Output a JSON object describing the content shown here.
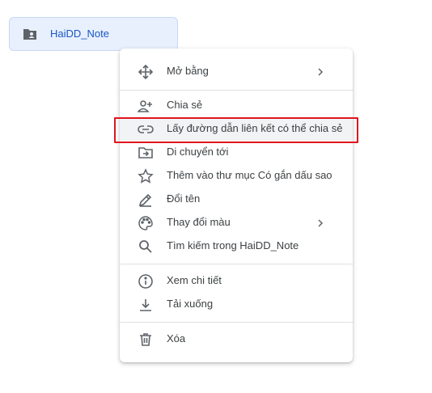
{
  "folder": {
    "name": "HaiDD_Note",
    "icon": "shared-folder-icon",
    "color": "#1a56c4"
  },
  "menu": {
    "items": [
      {
        "label": "Mở bằng",
        "icon": "move-arrows-icon",
        "has_submenu": true
      },
      {
        "label": "Chia sẻ",
        "icon": "add-person-icon",
        "has_submenu": false
      },
      {
        "label": "Lấy đường dẫn liên kết có thể chia sẻ",
        "icon": "link-icon",
        "has_submenu": false,
        "highlighted": true
      },
      {
        "label": "Di chuyển tới",
        "icon": "move-to-folder-icon",
        "has_submenu": false
      },
      {
        "label": "Thêm vào thư mục Có gắn dấu sao",
        "icon": "star-icon",
        "has_submenu": false
      },
      {
        "label": "Đổi tên",
        "icon": "pencil-icon",
        "has_submenu": false
      },
      {
        "label": "Thay đổi màu",
        "icon": "palette-icon",
        "has_submenu": true
      },
      {
        "label": "Tìm kiếm trong HaiDD_Note",
        "icon": "search-icon",
        "has_submenu": false
      },
      {
        "label": "Xem chi tiết",
        "icon": "info-icon",
        "has_submenu": false
      },
      {
        "label": "Tải xuống",
        "icon": "download-icon",
        "has_submenu": false
      },
      {
        "label": "Xóa",
        "icon": "trash-icon",
        "has_submenu": false
      }
    ]
  },
  "annotation_color": "#e0141e"
}
